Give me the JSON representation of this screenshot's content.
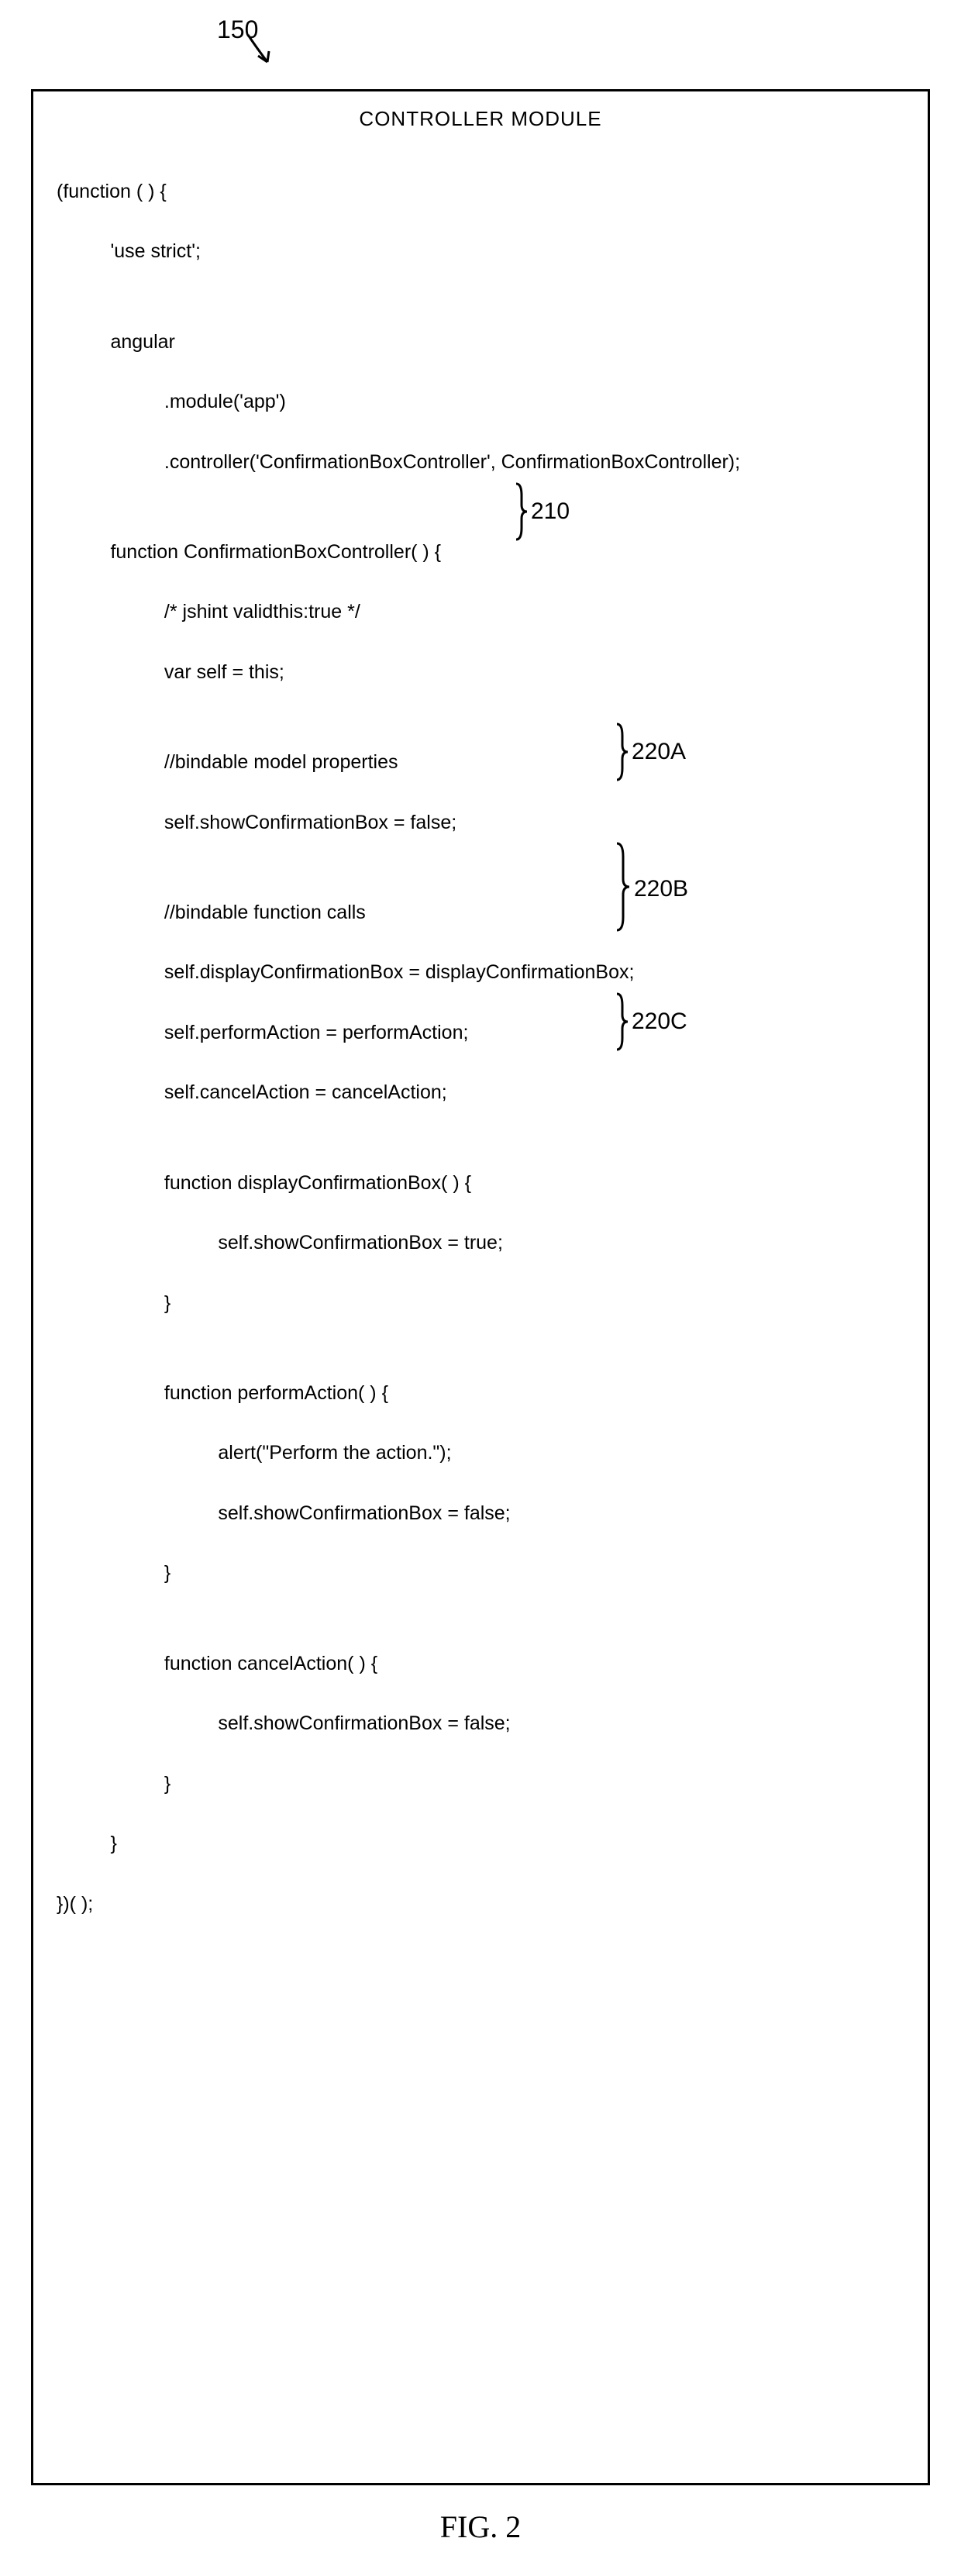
{
  "labels": {
    "top": "150",
    "boxTitle": "CONTROLLER MODULE",
    "callout210": "210",
    "callout220A": "220A",
    "callout220B": "220B",
    "callout220C": "220C",
    "figCaption": "FIG. 2"
  },
  "code": {
    "l1": "(function ( ) {",
    "l2": "          'use strict';",
    "l3": "",
    "l4": "          angular",
    "l5": "                    .module('app')",
    "l6": "                    .controller('ConfirmationBoxController', ConfirmationBoxController);",
    "l7": "",
    "l8": "          function ConfirmationBoxController( ) {",
    "l9": "                    /* jshint validthis:true */",
    "l10": "                    var self = this;",
    "l11": "",
    "l12": "                    //bindable model properties",
    "l13": "                    self.showConfirmationBox = false;",
    "l14": "",
    "l15": "                    //bindable function calls",
    "l16": "                    self.displayConfirmationBox = displayConfirmationBox;",
    "l17": "                    self.performAction = performAction;",
    "l18": "                    self.cancelAction = cancelAction;",
    "l19": "",
    "l20": "                    function displayConfirmationBox( ) {",
    "l21": "                              self.showConfirmationBox = true;",
    "l22": "                    }",
    "l23": "",
    "l24": "                    function performAction( ) {",
    "l25": "                              alert(\"Perform the action.\");",
    "l26": "                              self.showConfirmationBox = false;",
    "l27": "                    }",
    "l28": "",
    "l29": "                    function cancelAction( ) {",
    "l30": "                              self.showConfirmationBox = false;",
    "l31": "                    }",
    "l32": "          }",
    "l33": "})( );"
  }
}
